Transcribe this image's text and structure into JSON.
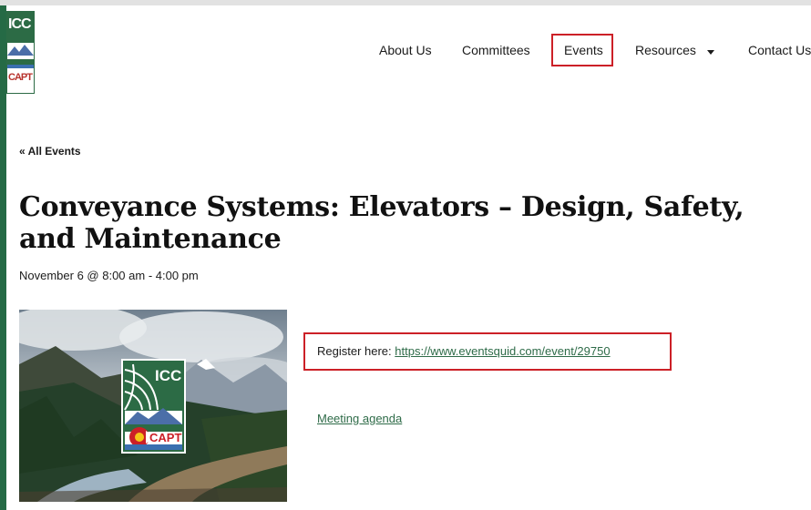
{
  "header": {
    "logo": {
      "top_text": "ICC",
      "bottom_text": "CAPT"
    },
    "nav": [
      {
        "label": "About Us"
      },
      {
        "label": "Committees"
      },
      {
        "label": "Events"
      },
      {
        "label": "Resources"
      },
      {
        "label": "Contact Us"
      }
    ]
  },
  "event": {
    "back_link": "« All Events",
    "title": "Conveyance Systems: Elevators – Design, Safety, and Maintenance",
    "date": "November 6 @ 8:00 am - 4:00 pm",
    "image_logo": {
      "top_text": "ICC",
      "bottom_text": "CAPT"
    },
    "register_label": "Register here:",
    "register_url": "https://www.eventsquid.com/event/29750",
    "agenda_link": "Meeting agenda"
  },
  "colors": {
    "brand_green": "#2c6b45",
    "link_green": "#2e6b48",
    "highlight_red": "#cc2027"
  },
  "icons": [
    "caret-down-icon",
    "icc-capt-logo"
  ]
}
